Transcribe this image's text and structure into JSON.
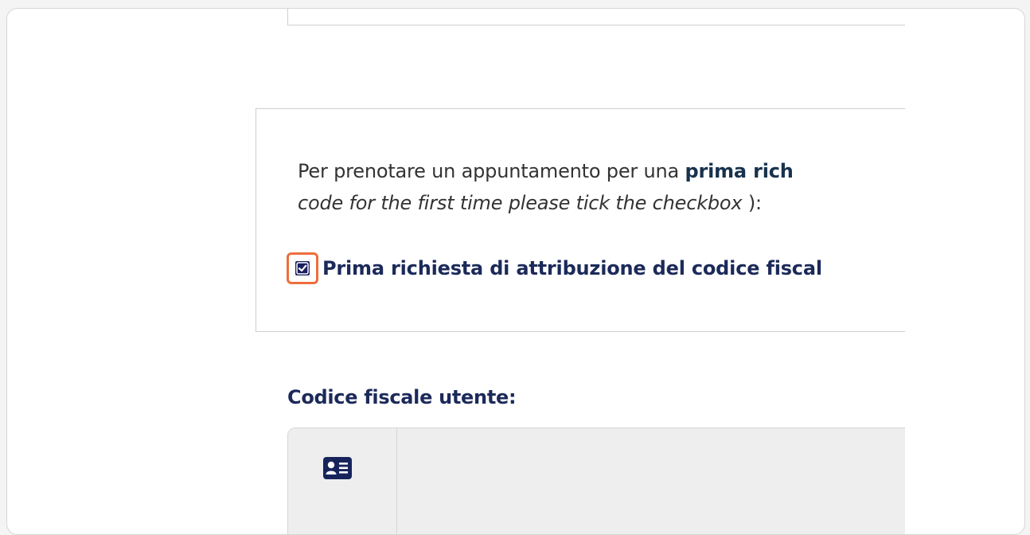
{
  "notice": {
    "line1_prefix": "Per prenotare un appuntamento per una ",
    "line1_bold": "prima rich",
    "line2_italic": "code for the first time please tick the checkbox",
    "line2_suffix": " ):"
  },
  "checkbox": {
    "checked": true,
    "label": "Prima richiesta di attribuzione del codice fiscal"
  },
  "fiscal_code": {
    "label": "Codice fiscale utente:",
    "icon": "id-card-icon",
    "value": "",
    "placeholder": ""
  },
  "colors": {
    "highlight": "#ee6e3c",
    "navy": "#1c2a5a",
    "checkbox_fill": "#1a1f5e"
  }
}
